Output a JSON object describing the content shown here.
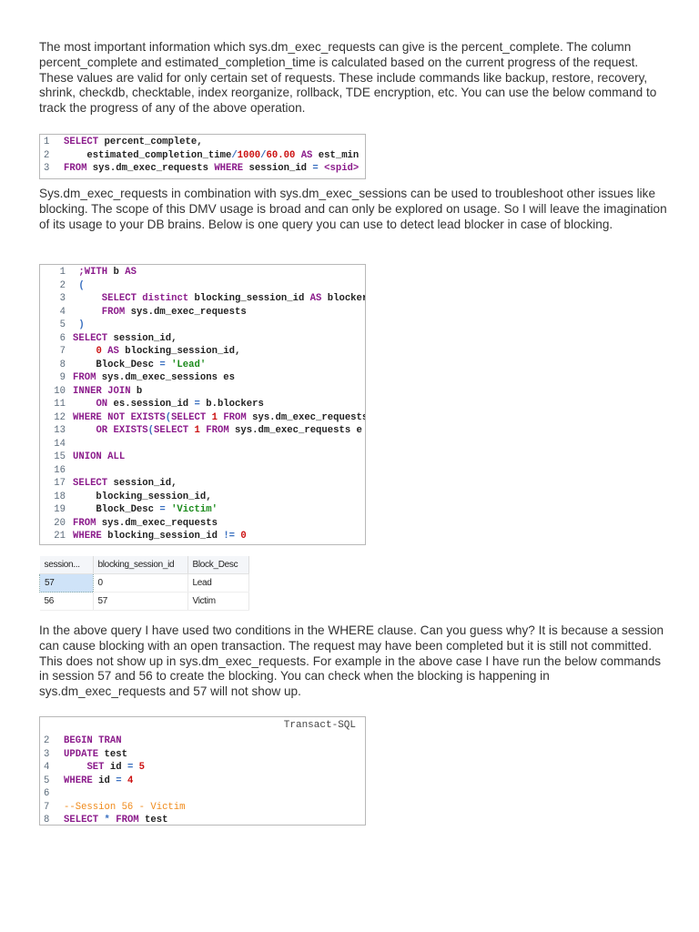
{
  "paragraphs": [
    "The most important information which sys.dm_exec_requests can give is the percent_complete. The column percent_complete and estimated_completion_time is calculated based on the current progress of the request. These values are valid for only certain set of requests. These include commands like backup, restore, recovery, shrink, checkdb, checktable, index reorganize, rollback, TDE encryption, etc. You can use the below command to track the progress of any of the above operation.",
    "Sys.dm_exec_requests in combination with sys.dm_exec_sessions can be used to troubleshoot other issues like blocking. The scope of this DMV usage is broad and can only be explored on usage. So I will leave the imagination of its usage to your DB brains. Below is one query you can use to detect lead blocker in case of blocking.",
    "In the above query I have used two conditions in the WHERE clause. Can you guess why? It is because a session can cause blocking with an open transaction. The request may have been completed but it is still not committed. This does not show up in sys.dm_exec_requests. For example in the above case I have run the below commands in session 57 and 56 to create the blocking. You can check when the blocking is happening in sys.dm_exec_requests and 57 will not show up."
  ],
  "code_blocks": [
    {
      "lines": [
        [
          "1",
          [
            [
              "kw",
              "SELECT"
            ],
            [
              "tx",
              " percent_complete,"
            ]
          ]
        ],
        [
          "2",
          [
            [
              "tx",
              "    estimated_completion_time"
            ],
            [
              "op",
              "/"
            ],
            [
              "num",
              "1000"
            ],
            [
              "op",
              "/"
            ],
            [
              "num",
              "60.00"
            ],
            [
              "tx",
              " "
            ],
            [
              "kw",
              "AS"
            ],
            [
              "tx",
              " est_min"
            ]
          ]
        ],
        [
          "3",
          [
            [
              "kw",
              "FROM"
            ],
            [
              "tx",
              " sys.dm_exec_requests "
            ],
            [
              "kw",
              "WHERE"
            ],
            [
              "tx",
              " session_id "
            ],
            [
              "op",
              "="
            ],
            [
              "tx",
              " "
            ],
            [
              "kw",
              "<spid>"
            ]
          ]
        ]
      ]
    },
    {
      "lines": [
        [
          "1",
          [
            [
              "tx",
              " "
            ],
            [
              "kw",
              ";WITH"
            ],
            [
              "tx",
              " b "
            ],
            [
              "kw",
              "AS"
            ]
          ]
        ],
        [
          "2",
          [
            [
              "tx",
              " "
            ],
            [
              "op",
              "("
            ]
          ]
        ],
        [
          "3",
          [
            [
              "tx",
              "     "
            ],
            [
              "kw",
              "SELECT distinct"
            ],
            [
              "tx",
              " blocking_session_id "
            ],
            [
              "kw",
              "AS"
            ],
            [
              "tx",
              " blockers"
            ]
          ]
        ],
        [
          "4",
          [
            [
              "tx",
              "     "
            ],
            [
              "kw",
              "FROM"
            ],
            [
              "tx",
              " sys.dm_exec_requests"
            ]
          ]
        ],
        [
          "5",
          [
            [
              "tx",
              " "
            ],
            [
              "op",
              ")"
            ]
          ]
        ],
        [
          "6",
          [
            [
              "kw",
              "SELECT"
            ],
            [
              "tx",
              " session_id,"
            ]
          ]
        ],
        [
          "7",
          [
            [
              "tx",
              "    "
            ],
            [
              "num",
              "0"
            ],
            [
              "tx",
              " "
            ],
            [
              "kw",
              "AS"
            ],
            [
              "tx",
              " blocking_session_id,"
            ]
          ]
        ],
        [
          "8",
          [
            [
              "tx",
              "    Block_Desc "
            ],
            [
              "op",
              "="
            ],
            [
              "tx",
              " "
            ],
            [
              "str",
              "'Lead'"
            ]
          ]
        ],
        [
          "9",
          [
            [
              "kw",
              "FROM"
            ],
            [
              "tx",
              " sys.dm_exec_sessions es"
            ]
          ]
        ],
        [
          "10",
          [
            [
              "kw",
              "INNER JOIN"
            ],
            [
              "tx",
              " b"
            ]
          ]
        ],
        [
          "11",
          [
            [
              "tx",
              "    "
            ],
            [
              "kw",
              "ON"
            ],
            [
              "tx",
              " es.session_id "
            ],
            [
              "op",
              "="
            ],
            [
              "tx",
              " b.blockers"
            ]
          ]
        ],
        [
          "12",
          [
            [
              "kw",
              "WHERE NOT EXISTS"
            ],
            [
              "op",
              "("
            ],
            [
              "kw",
              "SELECT"
            ],
            [
              "tx",
              " "
            ],
            [
              "num",
              "1"
            ],
            [
              "tx",
              " "
            ],
            [
              "kw",
              "FROM"
            ],
            [
              "tx",
              " sys.dm_exec_requests"
            ]
          ]
        ],
        [
          "13",
          [
            [
              "tx",
              "    "
            ],
            [
              "kw",
              "OR EXISTS"
            ],
            [
              "op",
              "("
            ],
            [
              "kw",
              "SELECT"
            ],
            [
              "tx",
              " "
            ],
            [
              "num",
              "1"
            ],
            [
              "tx",
              " "
            ],
            [
              "kw",
              "FROM"
            ],
            [
              "tx",
              " sys.dm_exec_requests e"
            ]
          ]
        ],
        [
          "14",
          []
        ],
        [
          "15",
          [
            [
              "kw",
              "UNION ALL"
            ]
          ]
        ],
        [
          "16",
          []
        ],
        [
          "17",
          [
            [
              "kw",
              "SELECT"
            ],
            [
              "tx",
              " session_id,"
            ]
          ]
        ],
        [
          "18",
          [
            [
              "tx",
              "    blocking_session_id,"
            ]
          ]
        ],
        [
          "19",
          [
            [
              "tx",
              "    Block_Desc "
            ],
            [
              "op",
              "="
            ],
            [
              "tx",
              " "
            ],
            [
              "str",
              "'Victim'"
            ]
          ]
        ],
        [
          "20",
          [
            [
              "kw",
              "FROM"
            ],
            [
              "tx",
              " sys.dm_exec_requests"
            ]
          ]
        ],
        [
          "21",
          [
            [
              "kw",
              "WHERE"
            ],
            [
              "tx",
              " blocking_session_id "
            ],
            [
              "op",
              "!="
            ],
            [
              "tx",
              " "
            ],
            [
              "num",
              "0"
            ]
          ]
        ]
      ]
    },
    {
      "header": "Transact-SQL",
      "lines": [
        [
          "2",
          [
            [
              "kw",
              "BEGIN TRAN"
            ]
          ]
        ],
        [
          "3",
          [
            [
              "kw",
              "UPDATE"
            ],
            [
              "tx",
              " test"
            ]
          ]
        ],
        [
          "4",
          [
            [
              "tx",
              "    "
            ],
            [
              "kw",
              "SET"
            ],
            [
              "tx",
              " id "
            ],
            [
              "op",
              "="
            ],
            [
              "tx",
              " "
            ],
            [
              "num",
              "5"
            ]
          ]
        ],
        [
          "5",
          [
            [
              "kw",
              "WHERE"
            ],
            [
              "tx",
              " id "
            ],
            [
              "op",
              "="
            ],
            [
              "tx",
              " "
            ],
            [
              "num",
              "4"
            ]
          ]
        ],
        [
          "6",
          []
        ],
        [
          "7",
          [
            [
              "cmt",
              "--Session 56 - Victim"
            ]
          ]
        ],
        [
          "8",
          [
            [
              "kw",
              "SELECT"
            ],
            [
              "tx",
              " "
            ],
            [
              "op",
              "*"
            ],
            [
              "tx",
              " "
            ],
            [
              "kw",
              "FROM"
            ],
            [
              "tx",
              " test"
            ]
          ]
        ]
      ]
    }
  ],
  "results_grid": {
    "columns": [
      "session...",
      "blocking_session_id",
      "Block_Desc"
    ],
    "rows": [
      [
        "57",
        "0",
        "Lead"
      ],
      [
        "56",
        "57",
        "Victim"
      ]
    ]
  }
}
